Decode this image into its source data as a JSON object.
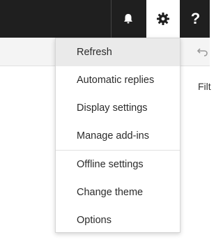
{
  "header": {
    "icons": [
      "bell-icon",
      "gear-icon",
      "help-icon"
    ],
    "help_glyph": "?",
    "colors": {
      "bar": "#1f1f1f",
      "active": "#ffffff"
    }
  },
  "toolbar": {
    "undo_icon": "undo-icon"
  },
  "content": {
    "filter_label_partial": "Filt"
  },
  "settings_menu": {
    "items": [
      {
        "label": "Refresh"
      },
      {
        "label": "Automatic replies"
      },
      {
        "label": "Display settings"
      },
      {
        "label": "Manage add-ins"
      },
      {
        "label": "Offline settings"
      },
      {
        "label": "Change theme"
      },
      {
        "label": "Options"
      }
    ]
  }
}
